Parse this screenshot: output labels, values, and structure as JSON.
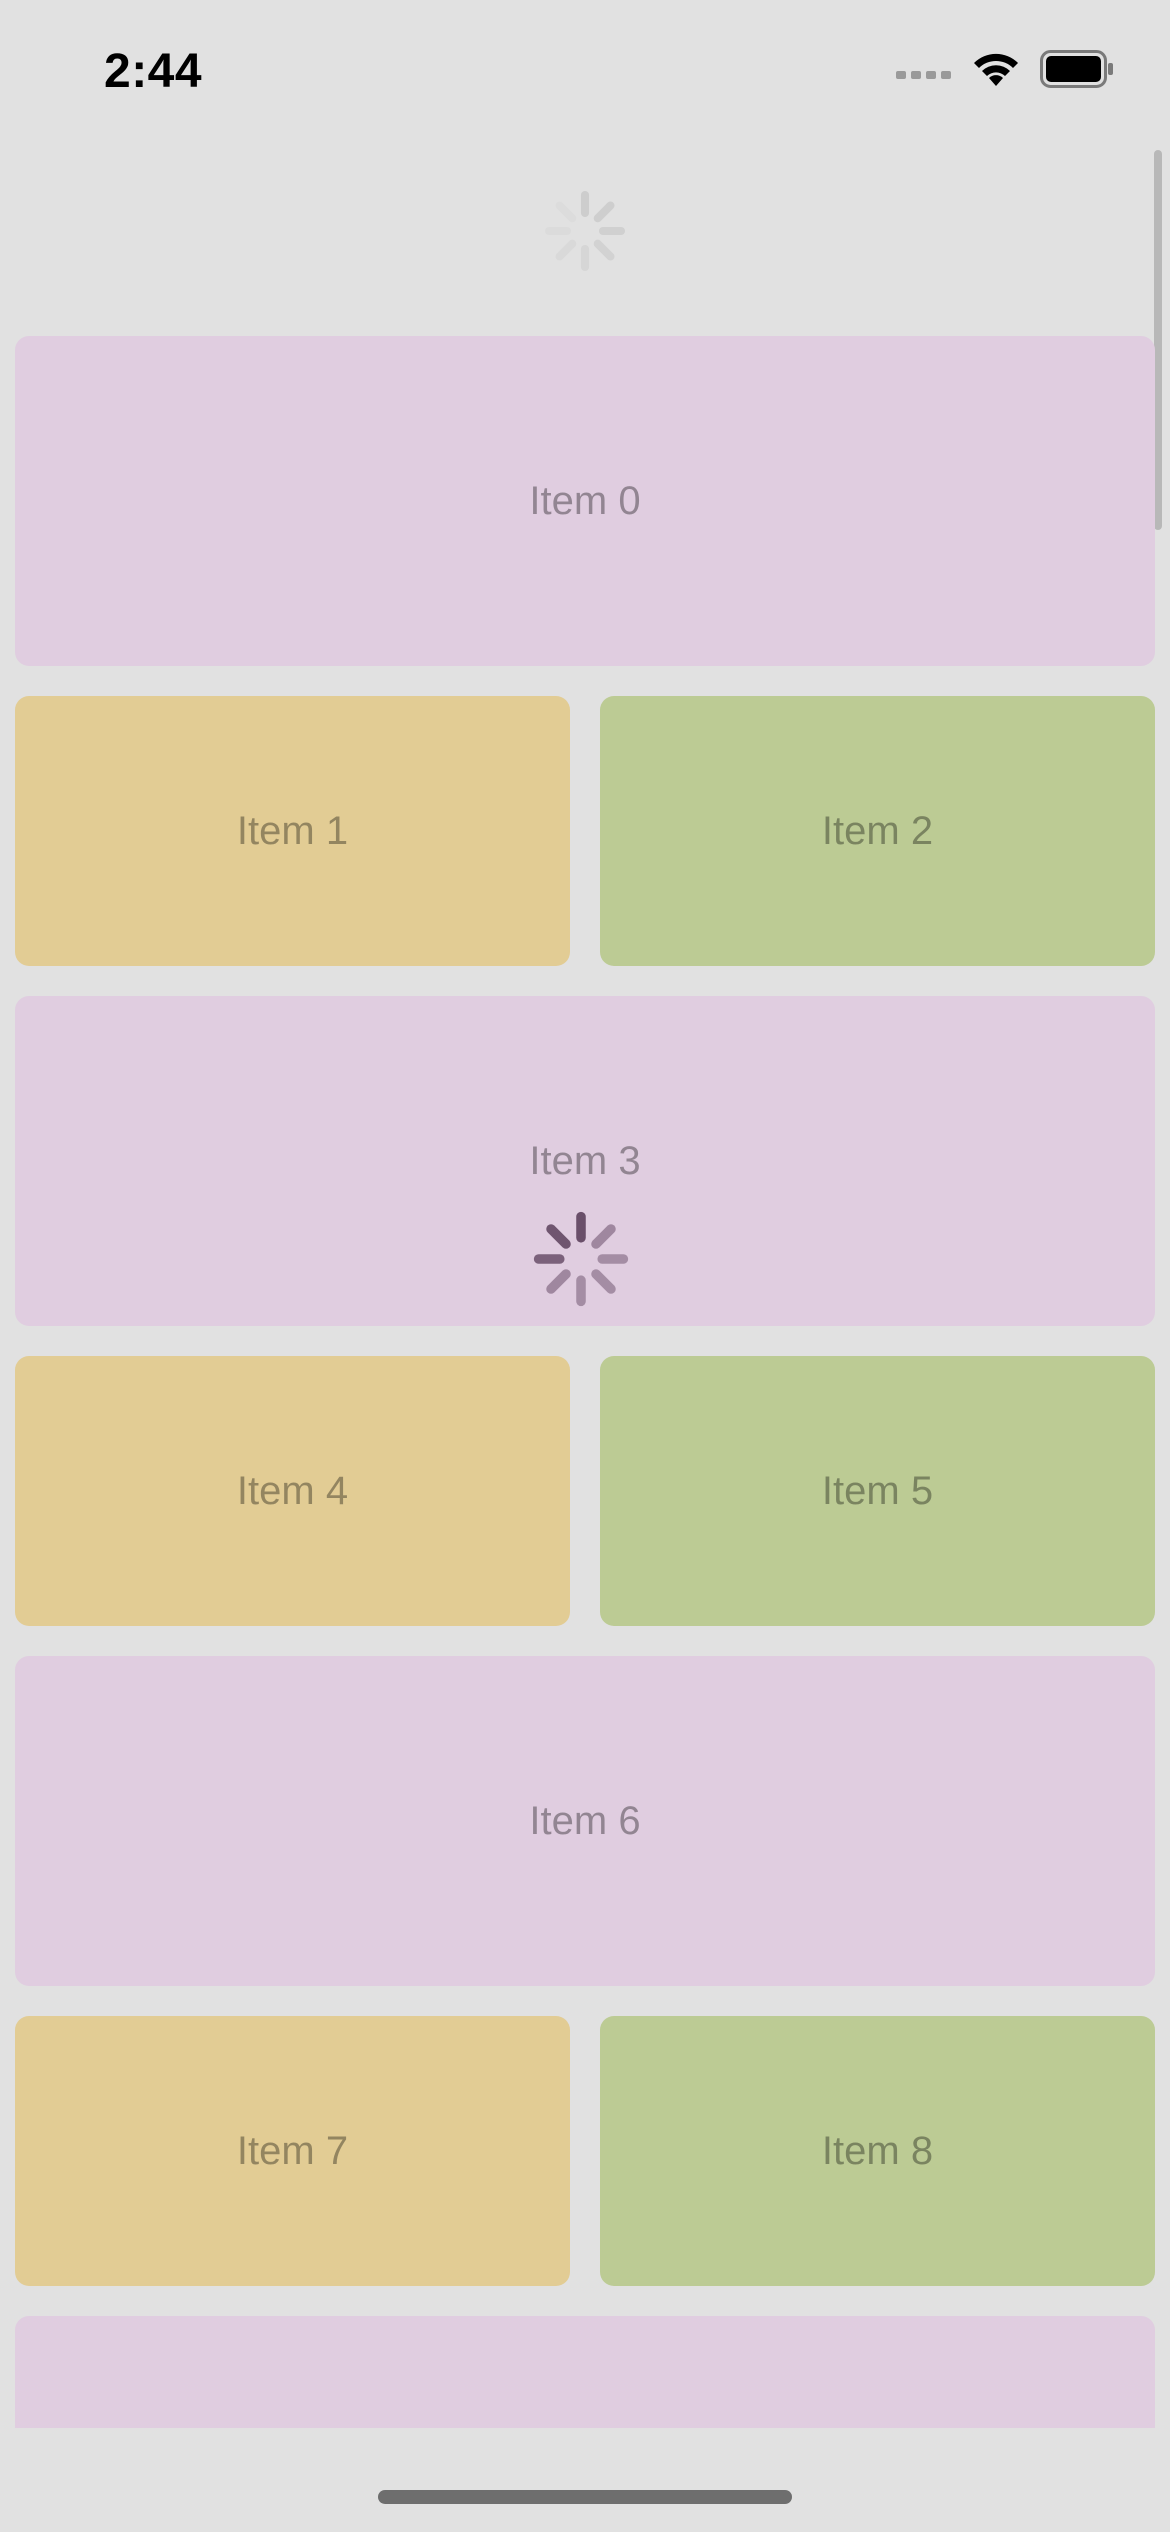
{
  "status_bar": {
    "time": "2:44",
    "icons": [
      "cellular-signal-icon",
      "wifi-icon",
      "battery-icon"
    ]
  },
  "refresh_spinner": {
    "icon": "activity-indicator-icon",
    "color": "#bdbdbd"
  },
  "loading_spinner": {
    "icon": "activity-indicator-icon",
    "color": "#6a4f6a"
  },
  "colors": {
    "background": "#e1e1e1",
    "purple": "#e0cde0",
    "yellow": "#e2cc94",
    "green": "#bccb94"
  },
  "items": [
    {
      "label": "Item 0"
    },
    {
      "label": "Item 1"
    },
    {
      "label": "Item 2"
    },
    {
      "label": "Item 3"
    },
    {
      "label": "Item 4"
    },
    {
      "label": "Item 5"
    },
    {
      "label": "Item 6"
    },
    {
      "label": "Item 7"
    },
    {
      "label": "Item 8"
    },
    {
      "label": ""
    }
  ]
}
